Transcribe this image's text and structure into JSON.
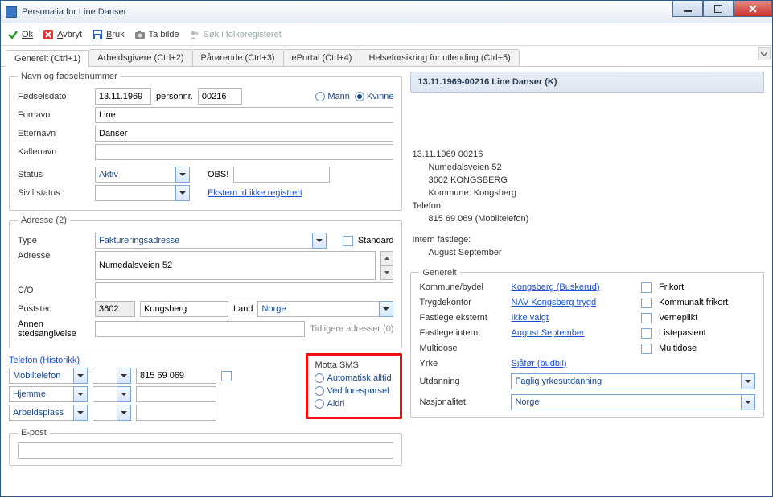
{
  "window": {
    "title": "Personalia for Line Danser"
  },
  "toolbar": {
    "ok": "Ok",
    "avbryt": "Avbryt",
    "bruk": "Bruk",
    "ta_bilde": "Ta bilde",
    "sok": "Søk i folkeregisteret"
  },
  "tabs": {
    "generelt": "Generelt (Ctrl+1)",
    "arbeidsgivere": "Arbeidsgivere (Ctrl+2)",
    "parorende": "Pårørende (Ctrl+3)",
    "eportal": "ePortal (Ctrl+4)",
    "helse": "Helseforsikring for utlending (Ctrl+5)"
  },
  "navn": {
    "legend": "Navn og fødselsnummer",
    "fodselsdato_lbl": "Fødselsdato",
    "fodselsdato": "13.11.1969",
    "personnr_lbl": "personnr.",
    "personnr": "00216",
    "mann": "Mann",
    "kvinne": "Kvinne",
    "fornavn_lbl": "Fornavn",
    "fornavn": "Line",
    "etternavn_lbl": "Etternavn",
    "etternavn": "Danser",
    "kallenavn_lbl": "Kallenavn",
    "kallenavn": "",
    "status_lbl": "Status",
    "status": "Aktiv",
    "obs_lbl": "OBS!",
    "obs": "",
    "sivil_lbl": "Sivil status:",
    "sivil": "",
    "ekstern": "Ekstern id ikke registrert"
  },
  "adresse": {
    "legend": "Adresse (2)",
    "type_lbl": "Type",
    "type": "Faktureringsadresse",
    "standard": "Standard",
    "adresse_lbl": "Adresse",
    "adresse": "Numedalsveien 52",
    "co_lbl": "C/O",
    "co": "",
    "poststed_lbl": "Poststed",
    "postnr": "3602",
    "poststed": "Kongsberg",
    "land_lbl": "Land",
    "land": "Norge",
    "annen_lbl": "Annen stedsangivelse",
    "annen": "",
    "tidligere": "Tidligere adresser (0)"
  },
  "telefon": {
    "link": "Telefon (Historikk)",
    "type1": "Mobiltelefon",
    "num1": "815 69 069",
    "type2": "Hjemme",
    "num2": "",
    "type3": "Arbeidsplass",
    "num3": ""
  },
  "sms": {
    "legend": "Motta SMS",
    "auto": "Automatisk alltid",
    "foresporsel": "Ved forespørsel",
    "aldri": "Aldri"
  },
  "epost": {
    "legend": "E-post",
    "value": ""
  },
  "info": {
    "header": "13.11.1969-00216 Line Danser (K)",
    "line1": "13.11.1969 00216",
    "line2": "Numedalsveien 52",
    "line3": "3602 KONGSBERG",
    "line4": "Kommune: Kongsberg",
    "line5": "Telefon:",
    "line6": "815 69 069 (Mobiltelefon)",
    "line7": "Intern fastlege:",
    "line8": "August September"
  },
  "gen": {
    "legend": "Generelt",
    "kommune_lbl": "Kommune/bydel",
    "kommune": "Kongsberg (Buskerud)",
    "frikort": "Frikort",
    "trygd_lbl": "Trygdekontor",
    "trygd": "NAV Kongsberg trygd",
    "kommunalt": "Kommunalt frikort",
    "ekst_lbl": "Fastlege eksternt",
    "ekst": "Ikke valgt",
    "verneplikt": "Verneplikt",
    "int_lbl": "Fastlege internt",
    "int": "August September",
    "listepasient": "Listepasient",
    "multidose_lbl": "Multidose",
    "multidose_chk": "Multidose",
    "yrke_lbl": "Yrke",
    "yrke": "Sjåfør (budbil)",
    "utd_lbl": "Utdanning",
    "utd": "Faglig yrkesutdanning",
    "nasj_lbl": "Nasjonalitet",
    "nasj": "Norge"
  }
}
